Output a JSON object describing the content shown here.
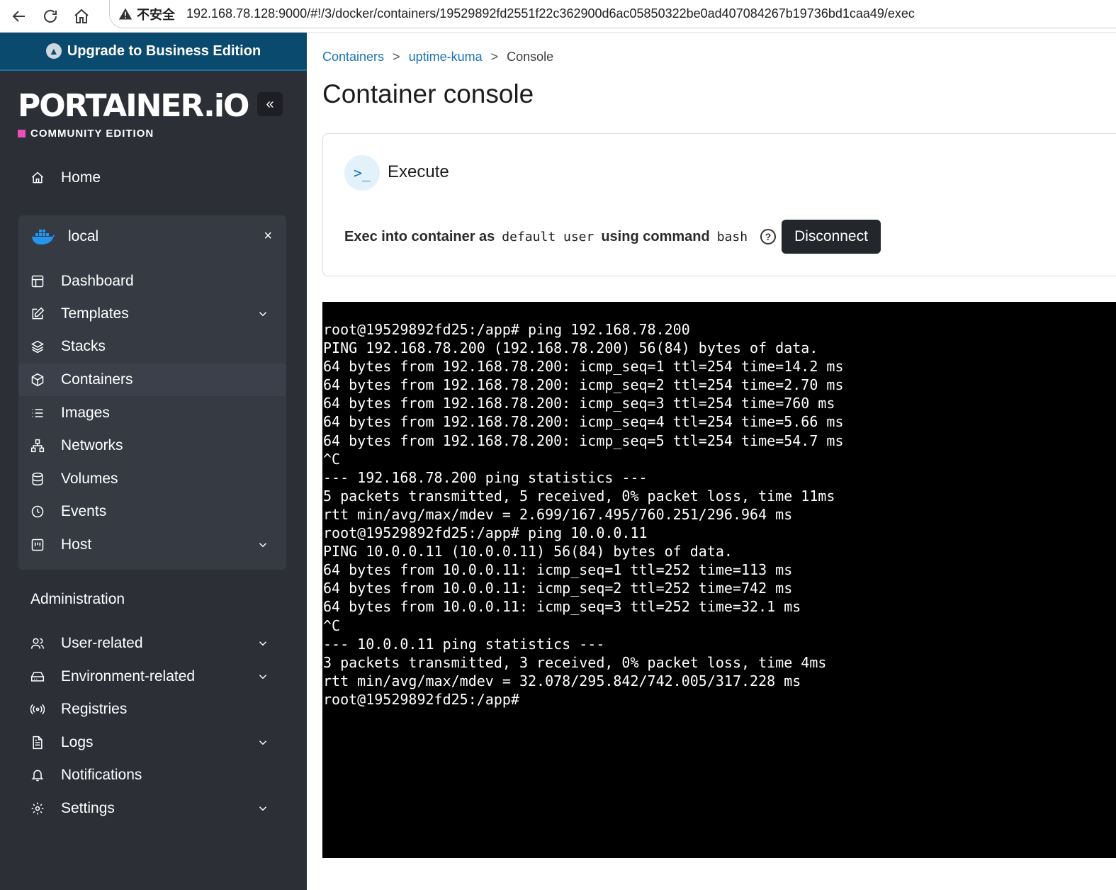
{
  "browser": {
    "security_label": "不安全",
    "url": "192.168.78.128:9000/#!/3/docker/containers/19529892fd2551f22c362900d6ac05850322be0ad407084267b19736bd1caa49/exec"
  },
  "sidebar": {
    "upgrade_label": "Upgrade to Business Edition",
    "logo_text": "PORTAINER.iO",
    "logo_sub": "COMMUNITY EDITION",
    "collapse_glyph": "«",
    "home_label": "Home",
    "environment": {
      "name": "local",
      "close_glyph": "×",
      "items": [
        {
          "label": "Dashboard"
        },
        {
          "label": "Templates"
        },
        {
          "label": "Stacks"
        },
        {
          "label": "Containers"
        },
        {
          "label": "Images"
        },
        {
          "label": "Networks"
        },
        {
          "label": "Volumes"
        },
        {
          "label": "Events"
        },
        {
          "label": "Host"
        }
      ]
    },
    "admin_label": "Administration",
    "admin_items": [
      {
        "label": "User-related"
      },
      {
        "label": "Environment-related"
      },
      {
        "label": "Registries"
      },
      {
        "label": "Logs"
      },
      {
        "label": "Notifications"
      },
      {
        "label": "Settings"
      }
    ]
  },
  "breadcrumb": {
    "items": [
      "Containers",
      "uptime-kuma",
      "Console"
    ],
    "separator": ">"
  },
  "page_title": "Container console",
  "execute_panel": {
    "icon_glyph": ">_",
    "title": "Execute",
    "text_prefix": "Exec into container as",
    "user_code": "default user",
    "text_mid": "using command",
    "command_code": "bash",
    "help_glyph": "?",
    "disconnect_label": "Disconnect"
  },
  "terminal": {
    "lines": [
      "root@19529892fd25:/app# ping 192.168.78.200",
      "PING 192.168.78.200 (192.168.78.200) 56(84) bytes of data.",
      "64 bytes from 192.168.78.200: icmp_seq=1 ttl=254 time=14.2 ms",
      "64 bytes from 192.168.78.200: icmp_seq=2 ttl=254 time=2.70 ms",
      "64 bytes from 192.168.78.200: icmp_seq=3 ttl=254 time=760 ms",
      "64 bytes from 192.168.78.200: icmp_seq=4 ttl=254 time=5.66 ms",
      "64 bytes from 192.168.78.200: icmp_seq=5 ttl=254 time=54.7 ms",
      "^C",
      "--- 192.168.78.200 ping statistics ---",
      "5 packets transmitted, 5 received, 0% packet loss, time 11ms",
      "rtt min/avg/max/mdev = 2.699/167.495/760.251/296.964 ms",
      "root@19529892fd25:/app# ping 10.0.0.11",
      "PING 10.0.0.11 (10.0.0.11) 56(84) bytes of data.",
      "64 bytes from 10.0.0.11: icmp_seq=1 ttl=252 time=113 ms",
      "64 bytes from 10.0.0.11: icmp_seq=2 ttl=252 time=742 ms",
      "64 bytes from 10.0.0.11: icmp_seq=3 ttl=252 time=32.1 ms",
      "^C",
      "--- 10.0.0.11 ping statistics ---",
      "3 packets transmitted, 3 received, 0% packet loss, time 4ms",
      "rtt min/avg/max/mdev = 32.078/295.842/742.005/317.228 ms",
      "root@19529892fd25:/app# "
    ]
  },
  "colors": {
    "sidebar_bg": "#2c2f36",
    "upgrade_bg": "#0b4a6f",
    "link": "#1a73b8",
    "terminal_bg": "#000000",
    "brand_pink": "#ec4fbc"
  }
}
